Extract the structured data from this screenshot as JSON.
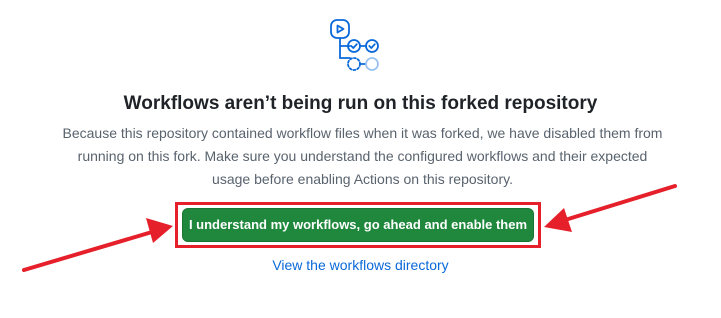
{
  "blankslate": {
    "icon": "workflow-icon",
    "title": "Workflows aren’t being run on this forked repository",
    "description_lines": [
      "Because this repository contained workflow files when it was forked, we have disabled them from",
      "running on this fork. Make sure you understand the configured workflows and their expected",
      "usage before enabling Actions on this repository."
    ],
    "enable_button_label": "I understand my workflows, go ahead and enable them",
    "directory_link_label": "View the workflows directory"
  },
  "colors": {
    "primary_button": "#1f883d",
    "link": "#0969da",
    "annotation": "#e5202a",
    "icon_blue": "#0969da"
  }
}
